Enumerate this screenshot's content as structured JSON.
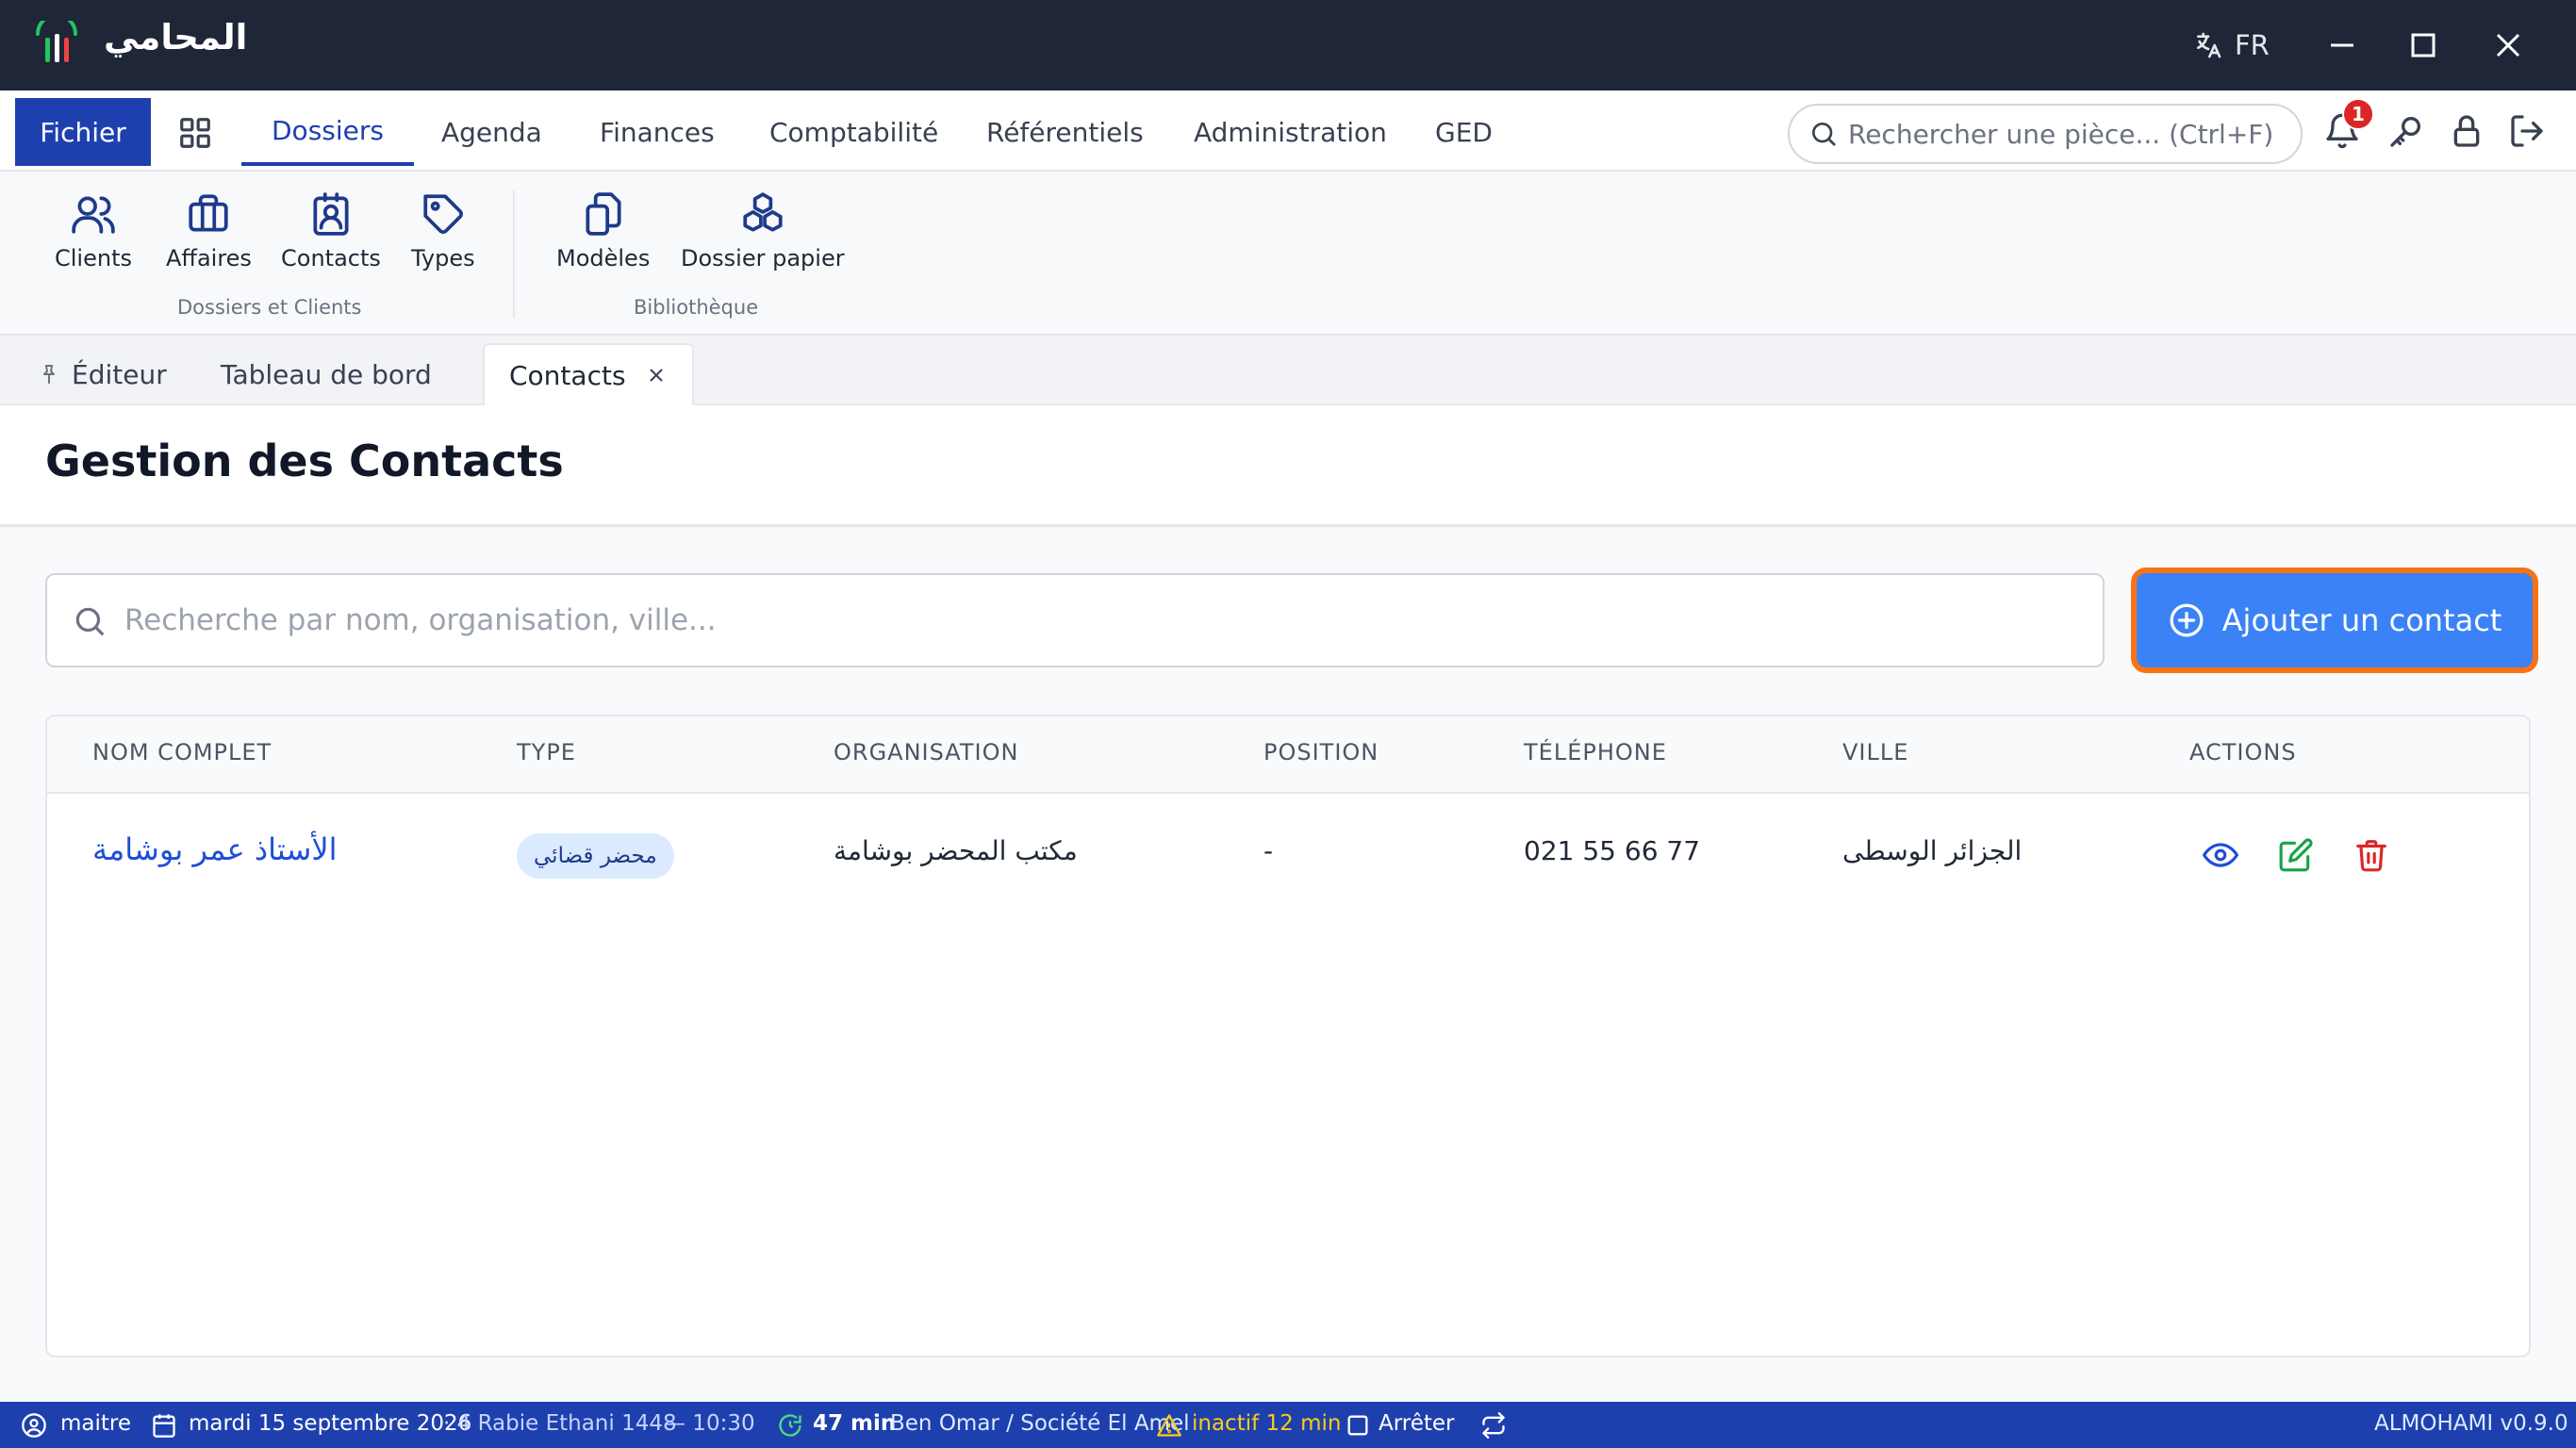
{
  "app": {
    "title": "المحامي",
    "language": "FR"
  },
  "menu": {
    "fichier": "Fichier",
    "items": [
      "Dossiers",
      "Agenda",
      "Finances",
      "Comptabilité",
      "Référentiels",
      "Administration",
      "GED"
    ],
    "active": "Dossiers",
    "search_placeholder": "Rechercher une pièce... (Ctrl+F)",
    "notification_count": "1"
  },
  "ribbon": {
    "groups": [
      {
        "label": "Dossiers et Clients",
        "buttons": [
          "Clients",
          "Affaires",
          "Contacts",
          "Types"
        ]
      },
      {
        "label": "Bibliothèque",
        "buttons": [
          "Modèles",
          "Dossier papier"
        ]
      }
    ]
  },
  "tabs": [
    {
      "label": "Éditeur",
      "pinned": true
    },
    {
      "label": "Tableau de bord"
    },
    {
      "label": "Contacts",
      "active": true,
      "closable": true
    }
  ],
  "page": {
    "title": "Gestion des Contacts",
    "search_placeholder": "Recherche par nom, organisation, ville...",
    "add_button": "Ajouter un contact"
  },
  "table": {
    "columns": [
      "NOM COMPLET",
      "TYPE",
      "ORGANISATION",
      "POSITION",
      "TÉLÉPHONE",
      "VILLE",
      "ACTIONS"
    ],
    "rows": [
      {
        "name": "الأستاذ عمر بوشامة",
        "type": "محضر قضائي",
        "organisation": "مكتب المحضر بوشامة",
        "position": "-",
        "telephone": "021 55 66 77",
        "ville": "الجزائر الوسطى"
      }
    ]
  },
  "status": {
    "user": "maitre",
    "date": "mardi 15 septembre 2026",
    "hijri": "· 4 Rabie Ethani 1448",
    "time": "— 10:30",
    "timer": "47 min",
    "client": "Ben Omar / Société El Amel",
    "inactive": "inactif 12 min",
    "stop": "Arrêter",
    "version": "ALMOHAMI v0.9.0"
  },
  "colors": {
    "titlebar": "#1e2637",
    "primary": "#1e40af",
    "accent_button": "#3b82f6",
    "highlight_ring": "#f97316",
    "danger": "#dc2626",
    "success": "#16a34a",
    "warning": "#facc15"
  }
}
